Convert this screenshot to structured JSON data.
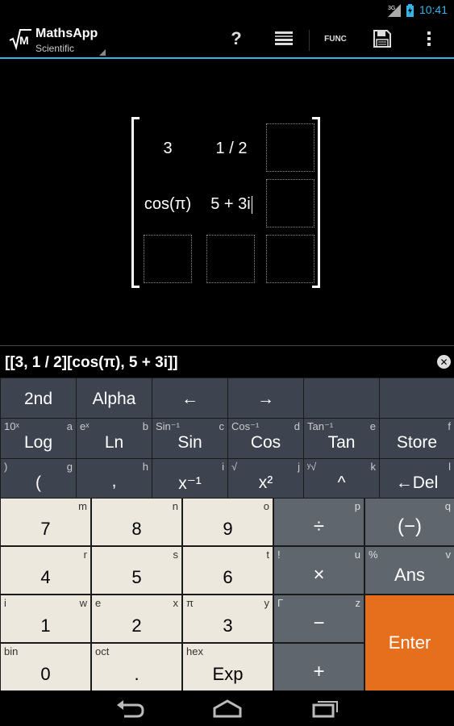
{
  "status": {
    "network": "3G",
    "time": "10:41"
  },
  "actionbar": {
    "title": "MathsApp",
    "subtitle": "Scientific",
    "help_label": "?",
    "func_label": "FUNC"
  },
  "matrix": {
    "r1c1": "3",
    "r1c2": "1 / 2",
    "r2c1": "cos(π)",
    "r2c2": "5 + 3i"
  },
  "expression": "[[3, 1 / 2][cos(π), 5 + 3i]]",
  "keys": {
    "k2nd": {
      "main": "2nd"
    },
    "alpha": {
      "main": "Alpha"
    },
    "left": {
      "main": "←"
    },
    "right": {
      "main": "→"
    },
    "log": {
      "main": "Log",
      "sub_l": "10ˣ",
      "sub_r": "a"
    },
    "ln": {
      "main": "Ln",
      "sub_l": "eˣ",
      "sub_r": "b"
    },
    "sin": {
      "main": "Sin",
      "sub_l": "Sin⁻¹",
      "sub_r": "c"
    },
    "cos": {
      "main": "Cos",
      "sub_l": "Cos⁻¹",
      "sub_r": "d"
    },
    "tan": {
      "main": "Tan",
      "sub_l": "Tan⁻¹",
      "sub_r": "e"
    },
    "store": {
      "main": "Store",
      "sub_r": "f"
    },
    "lparen": {
      "main": "(",
      "sub_l": ")",
      "sub_r": "g"
    },
    "comma": {
      "main": ",",
      "sub_r": "h"
    },
    "inv": {
      "main": "x⁻¹",
      "sub_r": "i"
    },
    "sq": {
      "main": "x²",
      "sub_l": "√",
      "sub_r": "j"
    },
    "pow": {
      "main": "^",
      "sub_l": "ʸ√",
      "sub_r": "k"
    },
    "del": {
      "main": "←Del",
      "sub_r": "l"
    },
    "n7": {
      "main": "7",
      "sub_r": "m"
    },
    "n8": {
      "main": "8",
      "sub_r": "n"
    },
    "n9": {
      "main": "9",
      "sub_r": "o"
    },
    "div": {
      "main": "÷",
      "sub_r": "p"
    },
    "neg": {
      "main": "(−)",
      "sub_r": "q"
    },
    "n4": {
      "main": "4",
      "sub_r": "r"
    },
    "n5": {
      "main": "5",
      "sub_r": "s"
    },
    "n6": {
      "main": "6",
      "sub_r": "t"
    },
    "mul": {
      "main": "×",
      "sub_l": "!",
      "sub_r": "u"
    },
    "ans": {
      "main": "Ans",
      "sub_l": "%",
      "sub_r": "v"
    },
    "n1": {
      "main": "1",
      "sub_l": "i",
      "sub_r": "w"
    },
    "n2": {
      "main": "2",
      "sub_l": "e",
      "sub_r": "x"
    },
    "n3": {
      "main": "3",
      "sub_l": "π",
      "sub_r": "y"
    },
    "minus": {
      "main": "−",
      "sub_l": "Γ",
      "sub_r": "z"
    },
    "enter": {
      "main": "Enter"
    },
    "n0": {
      "main": "0",
      "sub_l": "bin"
    },
    "dot": {
      "main": ".",
      "sub_l": "oct"
    },
    "exp": {
      "main": "Exp",
      "sub_l": "hex"
    },
    "plus": {
      "main": "+"
    }
  },
  "icons": {
    "app": "sqrt-m-icon",
    "help": "question-icon",
    "list": "list-icon",
    "save": "floppy-icon",
    "more": "overflow-icon",
    "back": "back-icon",
    "home": "home-icon",
    "recent": "recent-apps-icon"
  }
}
